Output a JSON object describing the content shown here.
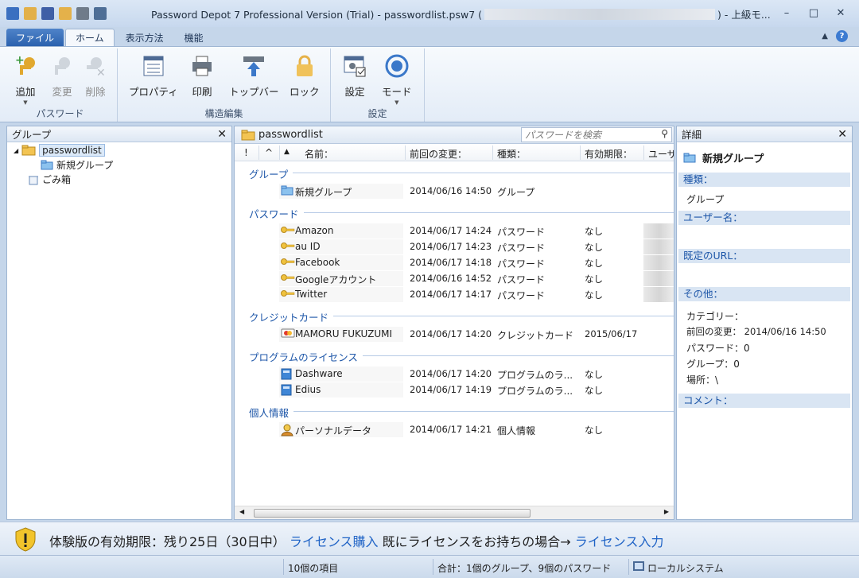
{
  "window": {
    "title_left": "Password Depot 7 Professional Version (Trial) - passwordlist.psw7 (",
    "title_right": ") - 上級モ..."
  },
  "ribbon_tabs": [
    "ファイル",
    "ホーム",
    "表示方法",
    "機能"
  ],
  "ribbon": {
    "groups": [
      {
        "label": "パスワード",
        "buttons": [
          "追加",
          "変更",
          "削除"
        ]
      },
      {
        "label": "構造編集",
        "buttons": [
          "プロパティ",
          "印刷",
          "トップバー",
          "ロック"
        ]
      },
      {
        "label": "設定",
        "buttons": [
          "設定",
          "モード"
        ]
      }
    ]
  },
  "left_pane": {
    "title": "グループ",
    "tree": [
      "passwordlist",
      "新規グループ",
      "ごみ箱"
    ]
  },
  "mid_pane": {
    "title": "passwordlist",
    "search_placeholder": "パスワードを検索",
    "columns": [
      "!",
      "^",
      "名前：",
      "前回の変更：",
      "種類：",
      "有効期限：",
      "ユーザ"
    ],
    "sections": [
      {
        "label": "グループ",
        "rows": [
          {
            "name": "新規グループ",
            "date": "2014/06/16 14:50",
            "type": "グループ",
            "expiry": "",
            "icon": "folder-icon"
          }
        ]
      },
      {
        "label": "パスワード",
        "rows": [
          {
            "name": "Amazon",
            "date": "2014/06/17 14:24",
            "type": "パスワード",
            "expiry": "なし",
            "icon": "key-icon"
          },
          {
            "name": "au ID",
            "date": "2014/06/17 14:23",
            "type": "パスワード",
            "expiry": "なし",
            "icon": "key-icon"
          },
          {
            "name": "Facebook",
            "date": "2014/06/17 14:18",
            "type": "パスワード",
            "expiry": "なし",
            "icon": "key-icon"
          },
          {
            "name": "Googleアカウント",
            "date": "2014/06/16 14:52",
            "type": "パスワード",
            "expiry": "なし",
            "icon": "key-icon"
          },
          {
            "name": "Twitter",
            "date": "2014/06/17 14:17",
            "type": "パスワード",
            "expiry": "なし",
            "icon": "key-icon"
          }
        ]
      },
      {
        "label": "クレジットカード",
        "rows": [
          {
            "name": "MAMORU FUKUZUMI",
            "date": "2014/06/17 14:20",
            "type": "クレジットカード",
            "expiry": "2015/06/17",
            "icon": "credit-card-icon"
          }
        ]
      },
      {
        "label": "プログラムのライセンス",
        "rows": [
          {
            "name": "Dashware",
            "date": "2014/06/17 14:20",
            "type": "プログラムのラ...",
            "expiry": "なし",
            "icon": "license-icon"
          },
          {
            "name": "Edius",
            "date": "2014/06/17 14:19",
            "type": "プログラムのラ...",
            "expiry": "なし",
            "icon": "license-icon"
          }
        ]
      },
      {
        "label": "個人情報",
        "rows": [
          {
            "name": "パーソナルデータ",
            "date": "2014/06/17 14:21",
            "type": "個人情報",
            "expiry": "なし",
            "icon": "person-icon"
          }
        ]
      }
    ]
  },
  "right_pane": {
    "title": "詳細",
    "item_name": "新規グループ",
    "bands": [
      "種類：",
      "ユーザー名：",
      "既定のURL：",
      "その他：",
      "コメント："
    ],
    "type_value": "グループ",
    "misc": [
      "カテゴリー：",
      "前回の変更： 2014/06/16 14:50",
      "パスワード：0",
      "グループ：0",
      "場所：\\"
    ]
  },
  "trial_bar": {
    "text1": "体験版の有効期限：残り25日（30日中）",
    "link1": "ライセンス購入",
    "text2": "既にライセンスをお持ちの場合→",
    "link2": "ライセンス入力"
  },
  "status_bar": {
    "count": "10個の項目",
    "summary": "合計：1個のグループ、9個のパスワード",
    "location": "ローカルシステム"
  },
  "colors": {
    "accent": "#1d56a8",
    "link": "#1f63c6",
    "frame": "#c5d6ea"
  }
}
